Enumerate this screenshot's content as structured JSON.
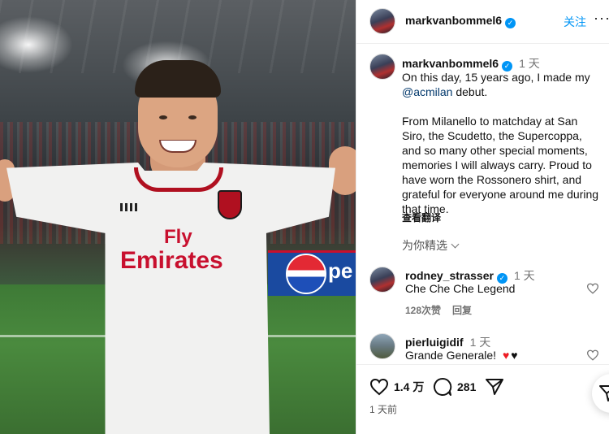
{
  "photo": {
    "jersey_sponsor_line1": "Fly",
    "jersey_sponsor_line2": "Emirates",
    "board_text": "pe"
  },
  "header": {
    "username": "markvanbommel6",
    "follow_label": "关注",
    "more_label": "···"
  },
  "post": {
    "username": "markvanbommel6",
    "time_ago": "1 天",
    "caption_line1_pre": "On this day, 15 years ago, I made my",
    "mention": "@acmilan",
    "caption_line1_post": " debut.",
    "caption_paragraph2": "From Milanello to matchday at San Siro, the Scudetto, the Supercoppa, and so many other special moments, memories I will always carry. Proud to have worn the Rossonero shirt, and grateful for everyone around me during that time.",
    "translate_label": "查看翻译"
  },
  "sort_label": "为你精选",
  "comments": [
    {
      "username": "rodney_strasser",
      "verified": true,
      "time_ago": "1 天",
      "text": "Che Che Che Legend",
      "likes": "128次赞",
      "reply": "回复"
    },
    {
      "username": "pierluigidif",
      "verified": false,
      "time_ago": "1 天",
      "text": "Grande Generale!",
      "emoji": "♥ ♥"
    }
  ],
  "actions": {
    "likes_count": "1.4 万",
    "comments_count": "281"
  },
  "posted_ago": "1 天前",
  "colors": {
    "accent_blue": "#0095f6",
    "mention_blue": "#00376b",
    "heart_red": "#ed1c24"
  }
}
